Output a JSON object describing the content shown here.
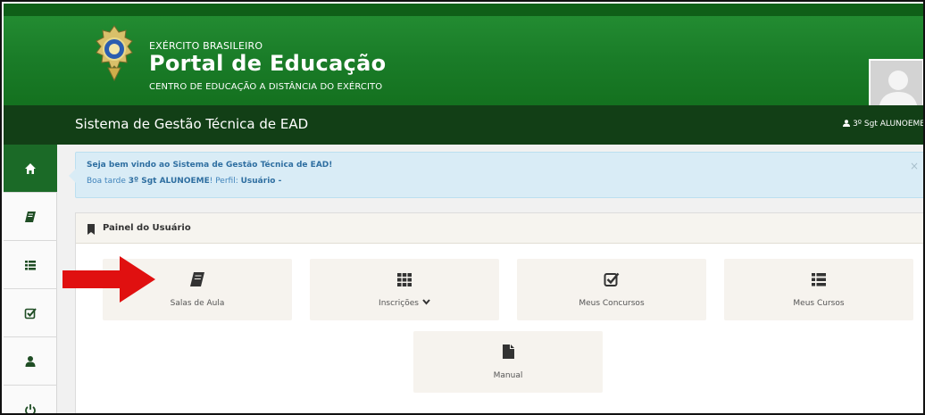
{
  "header": {
    "org": "EXÉRCITO BRASILEIRO",
    "title": "Portal de Educação",
    "subtitle": "CENTRO DE EDUCAÇÃO A DISTÂNCIA DO EXÉRCITO"
  },
  "titlebar": {
    "title": "Sistema de Gestão Técnica de EAD",
    "user": "3º Sgt ALUNOEME"
  },
  "sidebar": {
    "items": [
      {
        "icon": "home-icon"
      },
      {
        "icon": "book-icon"
      },
      {
        "icon": "list-icon"
      },
      {
        "icon": "checkbox-icon"
      },
      {
        "icon": "user-icon"
      },
      {
        "icon": "power-icon"
      }
    ]
  },
  "alert": {
    "line1": "Seja bem vindo ao Sistema de Gestão Técnica de EAD!",
    "greeting": "Boa tarde ",
    "user": "3º Sgt ALUNOEME",
    "profile_prefix": "! Perfil: ",
    "profile": "Usuário -",
    "close": "×"
  },
  "panel": {
    "title": "Painel do Usuário",
    "tiles": [
      {
        "label": "Salas de Aula",
        "icon": "book-icon"
      },
      {
        "label": "Inscrições",
        "icon": "grid-icon",
        "dropdown": true
      },
      {
        "label": "Meus Concursos",
        "icon": "checkbox-icon"
      },
      {
        "label": "Meus Cursos",
        "icon": "list-icon"
      },
      {
        "label": "Manual",
        "icon": "file-icon"
      }
    ]
  },
  "colors": {
    "header_green": "#1a7c28",
    "titlebar_green": "#123f16",
    "active_green": "#1b6a27",
    "alert_bg": "#d9ecf6",
    "tile_bg": "#f6f3ee",
    "arrow_red": "#e01010"
  }
}
